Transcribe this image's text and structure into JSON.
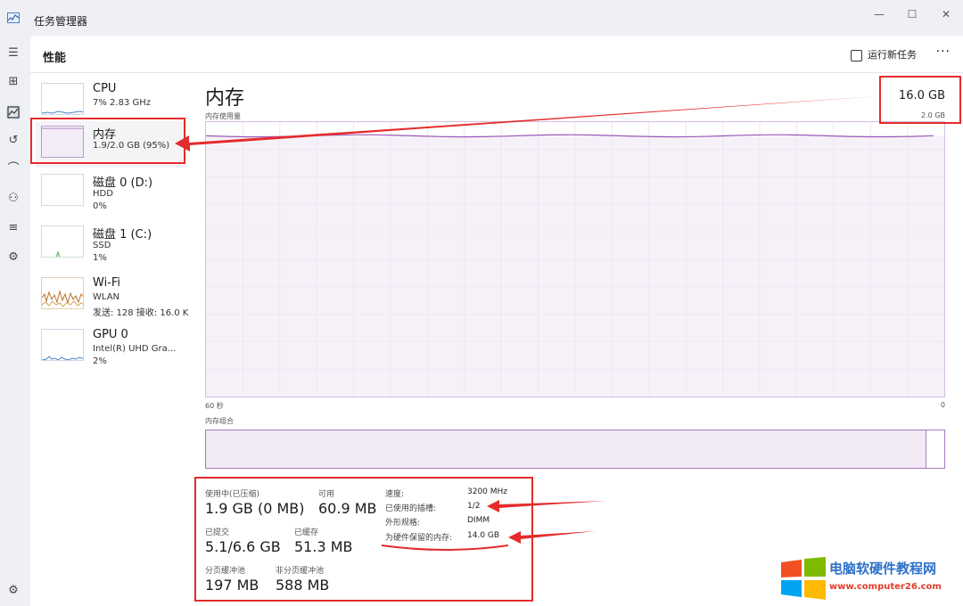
{
  "window": {
    "title": "任务管理器",
    "controls": [
      "—",
      "☐",
      "✕"
    ]
  },
  "rail": {
    "icons": [
      "hamburger-icon",
      "processes-icon",
      "performance-icon",
      "app-history-icon",
      "startup-icon",
      "users-icon",
      "details-icon",
      "services-icon",
      "settings-icon"
    ]
  },
  "header": {
    "title": "性能",
    "run_new_task": "运行新任务",
    "more": "···"
  },
  "sidebar": {
    "items": [
      {
        "title": "CPU",
        "sub": "7% 2.83 GHz",
        "sub2": ""
      },
      {
        "title": "内存",
        "sub": "1.9/2.0 GB (95%)",
        "sub2": ""
      },
      {
        "title": "磁盘 0 (D:)",
        "sub": "HDD",
        "sub2": "0%"
      },
      {
        "title": "磁盘 1 (C:)",
        "sub": "SSD",
        "sub2": "1%"
      },
      {
        "title": "Wi-Fi",
        "sub": "WLAN",
        "sub2": "发送: 128 接收: 16.0 K"
      },
      {
        "title": "GPU 0",
        "sub": "Intel(R) UHD Gra...",
        "sub2": "2%"
      }
    ]
  },
  "memory": {
    "title": "内存",
    "total": "16.0 GB",
    "usage_label": "内存使用量",
    "graph_max": "2.0 GB",
    "axis_left": "60 秒",
    "axis_right": "0",
    "composition_label": "内存组合",
    "composition_fill": 0.976,
    "usage_fraction": 0.95
  },
  "stats": {
    "in_use_label": "使用中(已压缩)",
    "in_use_value": "1.9 GB (0 MB)",
    "available_label": "可用",
    "available_value": "60.9 MB",
    "committed_label": "已提交",
    "committed_value": "5.1/6.6 GB",
    "cached_label": "已缓存",
    "cached_value": "51.3 MB",
    "paged_label": "分页缓冲池",
    "paged_value": "197 MB",
    "nonpaged_label": "非分页缓冲池",
    "nonpaged_value": "588 MB"
  },
  "specs": {
    "speed_label": "速度:",
    "speed_value": "3200 MHz",
    "slots_label": "已使用的插槽:",
    "slots_value": "1/2",
    "form_label": "外形规格:",
    "form_value": "DIMM",
    "reserved_label": "为硬件保留的内存:",
    "reserved_value": "14.0 GB"
  },
  "watermark": {
    "title": "电脑软硬件教程网",
    "url": "www.computer26.com"
  },
  "colors": {
    "accent": "#9b59b6",
    "annotation": "#e52b2b"
  }
}
